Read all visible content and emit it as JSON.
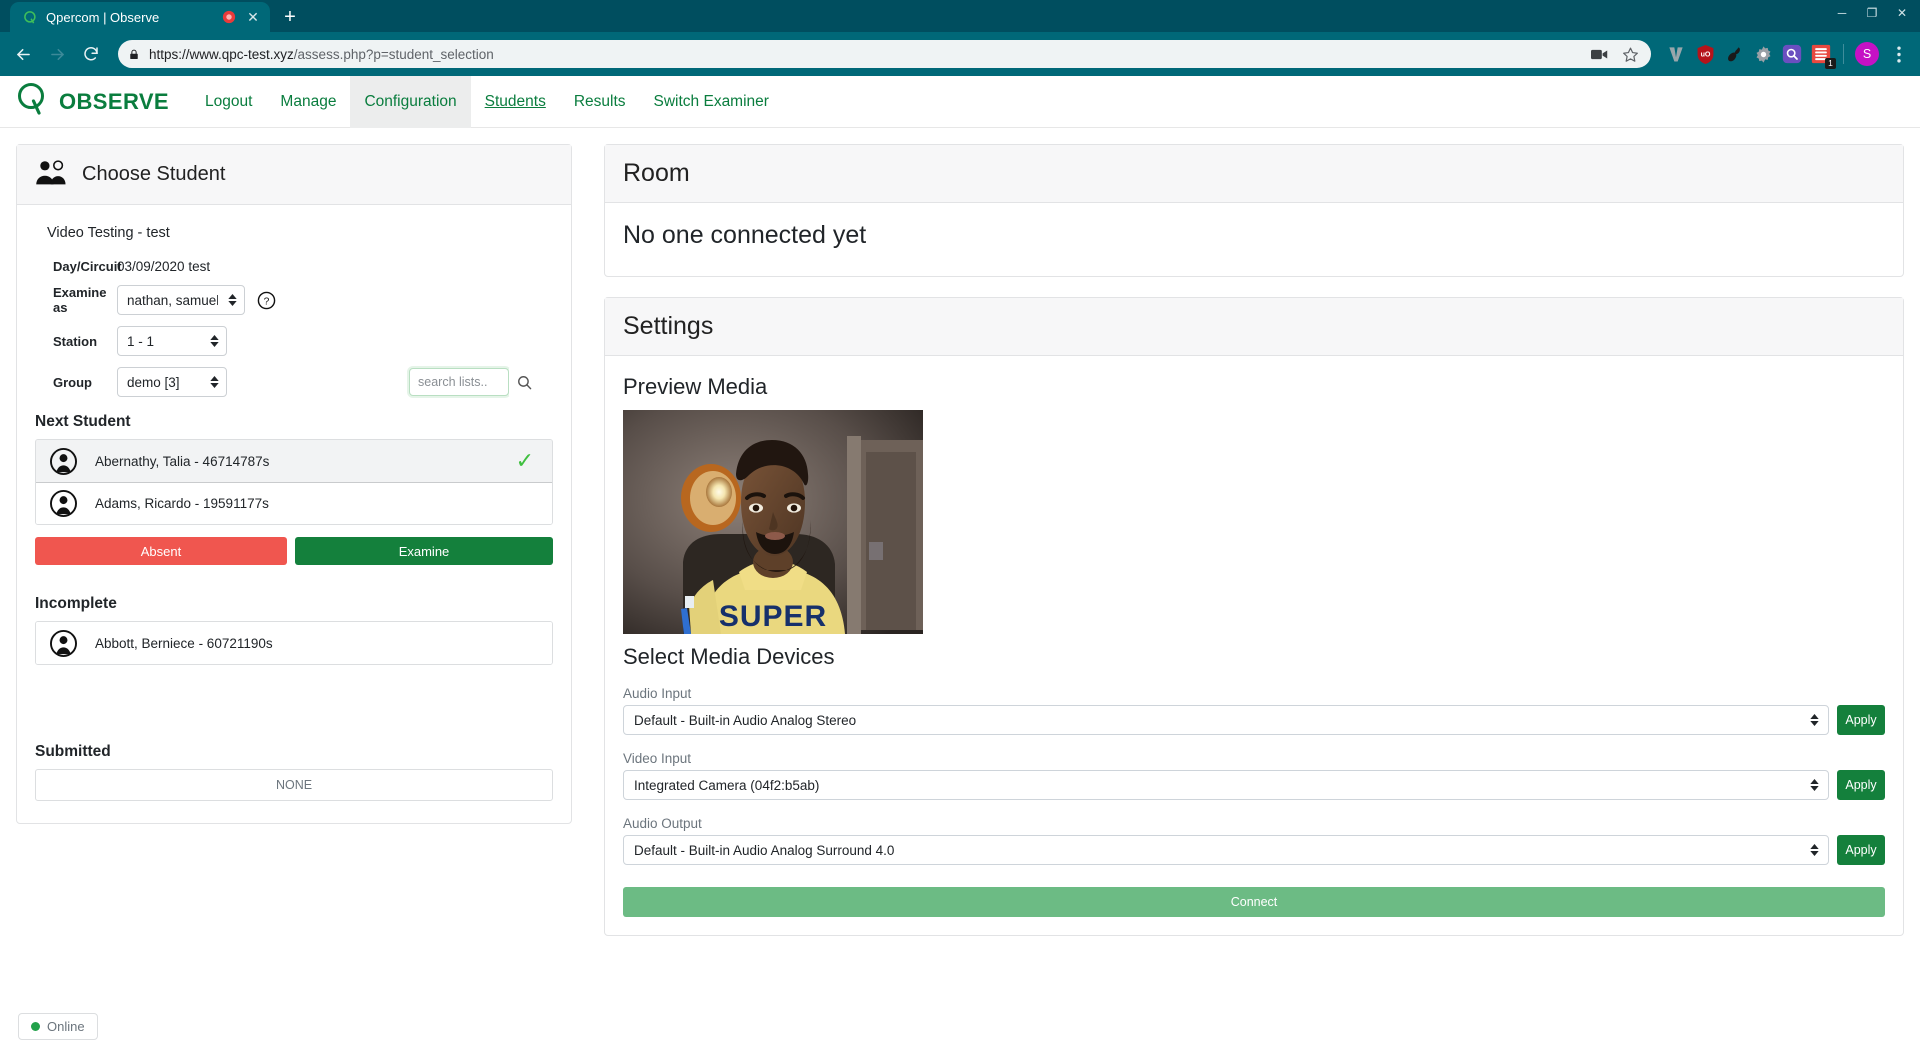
{
  "browser": {
    "tab": {
      "title": "Qpercom | Observe",
      "favicon_icon": "q-logo-icon",
      "recording_icon": "recording-indicator-icon",
      "close_icon": "close-icon"
    },
    "new_tab_icon": "new-tab-icon",
    "window_controls": {
      "minimize_icon": "minimize-icon",
      "maximize_icon": "maximize-icon",
      "close_icon": "close-icon"
    },
    "nav": {
      "back_icon": "back-arrow-icon",
      "forward_icon": "forward-arrow-icon",
      "reload_icon": "reload-icon"
    },
    "omnibox": {
      "lock_icon": "lock-icon",
      "url_secure": "https://www.qpc-test.xyz",
      "url_path": "/assess.php?p=student_selection",
      "url_full": "https://www.qpc-test.xyz/assess.php?p=student_selection",
      "media_icon": "video-camera-icon",
      "bookmark_icon": "star-icon"
    },
    "extensions": [
      {
        "name": "vimium-extension-icon",
        "label": "V",
        "color": "#8c9aa0"
      },
      {
        "name": "ublock-origin-extension-icon",
        "label": "uO",
        "color": "#b5131a"
      },
      {
        "name": "gnome-shell-extension-icon",
        "label": "",
        "color": "#1a1a1a"
      },
      {
        "name": "settings-gear-extension-icon",
        "label": "",
        "color": "#9aa0a6"
      },
      {
        "name": "search-extension-icon",
        "label": "",
        "color": "#6a4fc0"
      },
      {
        "name": "readwise-extension-icon",
        "label": "",
        "color": "#e8483f",
        "badge": "1"
      }
    ],
    "profile": {
      "name": "profile-avatar",
      "initial": "S",
      "color": "#c511c5"
    },
    "menu_icon": "three-dot-menu-icon"
  },
  "app": {
    "brand": {
      "name": "OBSERVE",
      "logo_icon": "q-observe-logo-icon",
      "color": "#0a7d3e"
    },
    "nav_links": [
      {
        "label": "Logout",
        "active": false,
        "underline": false
      },
      {
        "label": "Manage",
        "active": false,
        "underline": false
      },
      {
        "label": "Configuration",
        "active": true,
        "underline": false
      },
      {
        "label": "Students",
        "active": false,
        "underline": true
      },
      {
        "label": "Results",
        "active": false,
        "underline": false
      },
      {
        "label": "Switch Examiner",
        "active": false,
        "underline": false
      }
    ]
  },
  "left_panel": {
    "header": {
      "title": "Choose Student",
      "icon": "two-people-icon"
    },
    "session_title": "Video Testing - test",
    "fields": {
      "day_circuit_label": "Day/Circuit",
      "day_circuit_value": "03/09/2020 test",
      "examine_as_label": "Examine as",
      "examine_as_value": "nathan, samuel (you)",
      "help_icon": "question-mark-help-icon",
      "station_label": "Station",
      "station_value": "1 - 1",
      "group_label": "Group",
      "group_value": "demo [3]"
    },
    "search": {
      "placeholder": "search lists..",
      "value": "",
      "icon": "search-icon"
    },
    "next_student": {
      "title": "Next Student",
      "items": [
        {
          "name": "Abernathy, Talia - 46714787s",
          "selected": true,
          "check_icon": "checkmark-icon",
          "avatar_icon": "person-avatar-icon"
        },
        {
          "name": "Adams, Ricardo - 19591177s",
          "selected": false,
          "check_icon": "",
          "avatar_icon": "person-avatar-icon"
        }
      ]
    },
    "buttons": {
      "absent": "Absent",
      "examine": "Examine",
      "absent_color": "#f0564f",
      "examine_color": "#14803c"
    },
    "incomplete": {
      "title": "Incomplete",
      "items": [
        {
          "name": "Abbott, Berniece - 60721190s",
          "avatar_icon": "person-avatar-icon"
        }
      ]
    },
    "submitted": {
      "title": "Submitted",
      "empty_label": "NONE"
    }
  },
  "right_panel": {
    "room": {
      "title": "Room",
      "message": "No one connected yet"
    },
    "settings": {
      "title": "Settings",
      "preview_media_title": "Preview Media",
      "video_preview_name": "webcam-preview",
      "select_devices_title": "Select Media Devices",
      "devices": [
        {
          "label": "Audio Input",
          "value": "Default - Built-in Audio Analog Stereo",
          "apply": "Apply",
          "name": "audio-input"
        },
        {
          "label": "Video Input",
          "value": "Integrated Camera (04f2:b5ab)",
          "apply": "Apply",
          "name": "video-input"
        },
        {
          "label": "Audio Output",
          "value": "Default - Built-in Audio Analog Surround 4.0",
          "apply": "Apply",
          "name": "audio-output"
        }
      ],
      "connect_label": "Connect",
      "connect_color": "#6cbb84"
    }
  },
  "status": {
    "label": "Online",
    "dot_color": "#22a14a"
  }
}
